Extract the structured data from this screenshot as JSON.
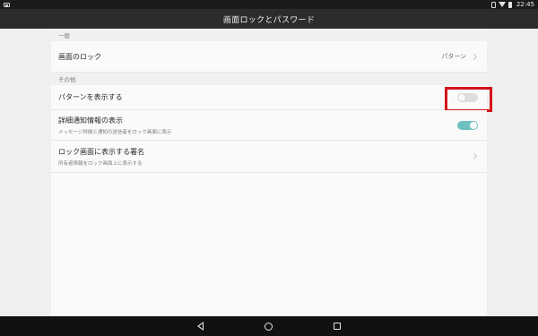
{
  "status_bar": {
    "time": "22:45"
  },
  "app_bar": {
    "title": "画面ロックとパスワード"
  },
  "sections": {
    "general": {
      "header": "一般"
    },
    "other": {
      "header": "その他"
    }
  },
  "rows": {
    "screen_lock": {
      "title": "画面のロック",
      "value": "パターン"
    },
    "show_pattern": {
      "title": "パターンを表示する",
      "toggle": "off"
    },
    "detailed_notifications": {
      "title": "詳細通知情報の表示",
      "subtitle": "メッセージ詳細と通知の送信者をロック画面に表示",
      "toggle": "on"
    },
    "lock_screen_signature": {
      "title": "ロック画面に表示する署名",
      "subtitle": "所有者情報をロック画面上に表示する"
    }
  },
  "colors": {
    "toggle_on": "#6fc1c0",
    "highlight": "#d4141b",
    "app_bar": "#2c2c2c"
  }
}
